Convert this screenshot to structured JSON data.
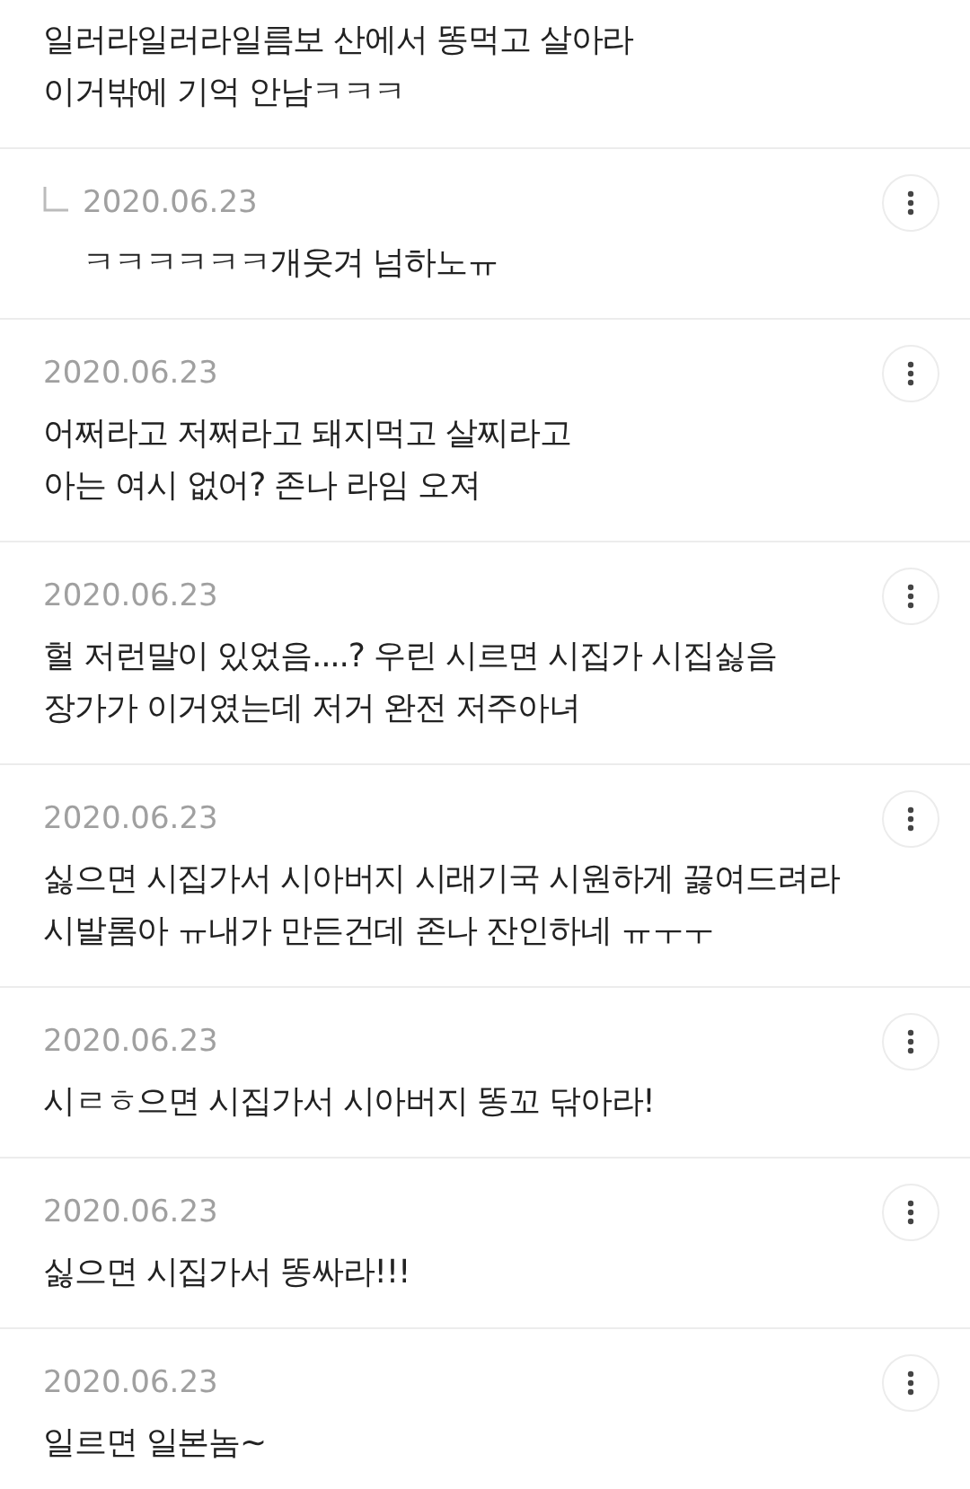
{
  "comments": [
    {
      "reply": false,
      "text": "일러라일러라일름보 산에서 똥먹고 살아라\n이거밖에 기억 안남ㅋㅋㅋ"
    },
    {
      "reply": true,
      "date": "2020.06.23",
      "text": "ㅋㅋㅋㅋㅋㅋ개웃겨 넘하노ㅠ"
    },
    {
      "reply": false,
      "date": "2020.06.23",
      "text": "어쩌라고 저쩌라고 돼지먹고 살찌라고\n아는 여시 없어?  존나 라임 오져"
    },
    {
      "reply": false,
      "date": "2020.06.23",
      "text": "헐 저런말이 있었음....?  우린 시르면 시집가 시집싫음\n장가가 이거였는데 저거 완전 저주아녀"
    },
    {
      "reply": false,
      "date": "2020.06.23",
      "text": "싫으면 시집가서 시아버지 시래기국 시원하게 끓여드려라\n시발롬아 ㅠ내가 만든건데 존나 잔인하네 ㅠㅜㅜ"
    },
    {
      "reply": false,
      "date": "2020.06.23",
      "text": "시ㄹㅎ으면 시집가서 시아버지 똥꼬 닦아라!"
    },
    {
      "reply": false,
      "date": "2020.06.23",
      "text": "싫으면 시집가서 똥싸라!!!"
    },
    {
      "reply": false,
      "date": "2020.06.23",
      "text": "일르면 일본놈~"
    }
  ]
}
